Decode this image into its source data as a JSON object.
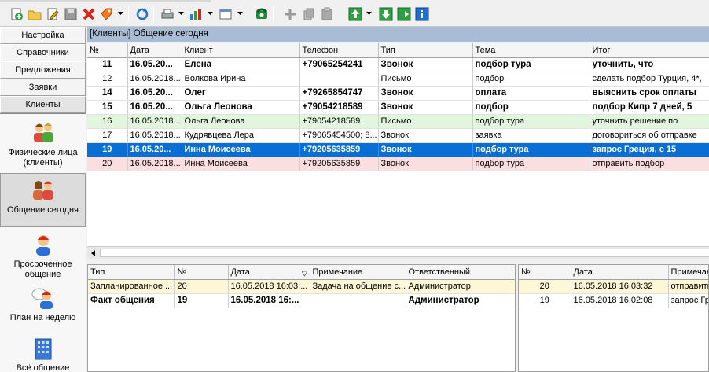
{
  "toolbar": {
    "buttons": [
      "add-icon",
      "folder-icon",
      "edit-icon",
      "save-icon",
      "delete-icon",
      "tag-icon",
      "refresh-icon",
      "print-icon",
      "chart-icon",
      "window-icon",
      "phone-icon",
      "move-icon",
      "copy-icon",
      "paste-icon",
      "export-up-icon",
      "import-icon",
      "import-alt-icon",
      "info-icon"
    ]
  },
  "nav": {
    "buttons": [
      "Настройка",
      "Справочники",
      "Предложения",
      "Заявки",
      "Клиенты"
    ],
    "items": [
      {
        "label": "Физические лица (клиенты)",
        "icon": "people-icon"
      },
      {
        "label": "Общение сегодня",
        "icon": "chat-people-icon"
      },
      {
        "label": "Просроченное общение",
        "icon": "person-red-icon"
      },
      {
        "label": "План на неделю",
        "icon": "person-plan-icon"
      },
      {
        "label": "Всё общение",
        "icon": "building-icon"
      }
    ]
  },
  "panel": {
    "title": "[Клиенты] Общение сегодня"
  },
  "main_grid": {
    "columns": [
      "№",
      "Дата",
      "Клиент",
      "Телефон",
      "Тип",
      "Тема",
      "Итог"
    ],
    "rows": [
      {
        "style": "bold",
        "cells": [
          "11",
          "16.05.20...",
          "Елена",
          "+79065254241",
          "Звонок",
          "подбор тура",
          "уточнить, что"
        ]
      },
      {
        "style": "normal",
        "cells": [
          "12",
          "16.05.2018...",
          "Волкова Ирина",
          "",
          "Письмо",
          "подбор",
          "сделать подбор Турция, 4*,"
        ]
      },
      {
        "style": "bold",
        "cells": [
          "14",
          "16.05.20...",
          "Олег",
          "+79265854747",
          "Звонок",
          "оплата",
          "выяснить срок оплаты"
        ]
      },
      {
        "style": "bold",
        "cells": [
          "15",
          "16.05.20...",
          "Ольга Леонова",
          "+79054218589",
          "Звонок",
          "подбор",
          "подбор Кипр 7 дней, 5"
        ]
      },
      {
        "style": "green",
        "cells": [
          "16",
          "16.05.2018...",
          "Ольга Леонова",
          "+79054218589",
          "Письмо",
          "подбор тура",
          "уточнить решение по"
        ]
      },
      {
        "style": "normal",
        "cells": [
          "17",
          "16.05.2018...",
          "Кудрявцева Лера",
          "+79065454500; 8...",
          "Звонок",
          "заявка",
          "договориться об отправке"
        ]
      },
      {
        "style": "sel",
        "cells": [
          "19",
          "16.05.20...",
          "Инна Моисеева",
          "+79205635859",
          "Звонок",
          "подбор тура",
          "запрос Греция, с 15"
        ]
      },
      {
        "style": "pink",
        "cells": [
          "20",
          "16.05.2018...",
          "Инна Моисеева",
          "+79205635859",
          "Звонок",
          "подбор тура",
          "отправить подбор"
        ]
      }
    ]
  },
  "sub_grid_left": {
    "columns": [
      "Тип",
      "№",
      "Дата",
      "Примечание",
      "Ответственный"
    ],
    "rows": [
      {
        "style": "yellow",
        "cells": [
          "Запланированное ...",
          "20",
          "16.05.2018 16:03:...",
          "Задача на общение с...",
          "Администратор"
        ]
      },
      {
        "style": "bold",
        "cells": [
          "Факт общения",
          "19",
          "16.05.2018 16:...",
          "",
          "Администратор"
        ]
      }
    ]
  },
  "sub_grid_right": {
    "columns": [
      "№",
      "Дата",
      "Примечан"
    ],
    "rows": [
      {
        "style": "yellow",
        "cells": [
          "20",
          "16.05.2018 16:03:32",
          "отправить"
        ]
      },
      {
        "style": "normal",
        "cells": [
          "19",
          "16.05.2018 16:02:08",
          "запрос Гре"
        ]
      }
    ]
  }
}
